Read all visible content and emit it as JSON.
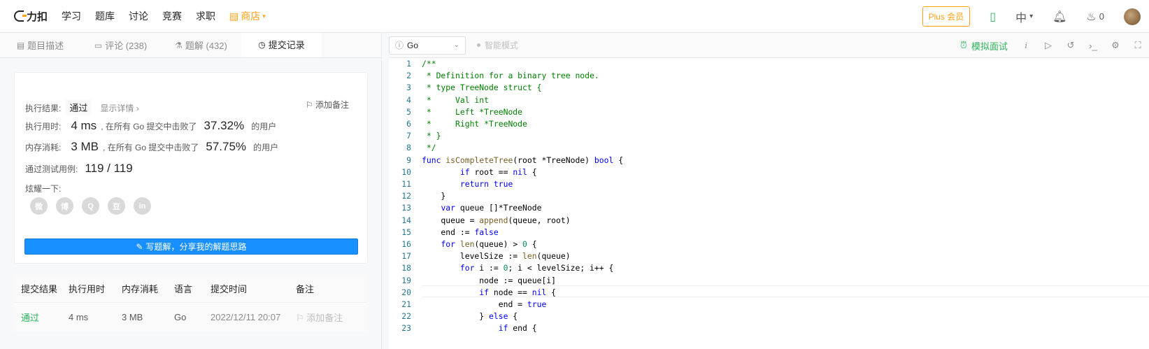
{
  "nav": {
    "logo": "力扣",
    "items": [
      "学习",
      "题库",
      "讨论",
      "竞赛",
      "求职"
    ],
    "store": "商店",
    "plus": "Plus 会员",
    "lang": "中",
    "points": "0"
  },
  "tabs": [
    {
      "label": "题目描述",
      "icon": "document-icon"
    },
    {
      "label": "评论 (238)",
      "icon": "comment-icon"
    },
    {
      "label": "题解 (432)",
      "icon": "flask-icon"
    },
    {
      "label": "提交记录",
      "icon": "clock-icon"
    }
  ],
  "result": {
    "status_label": "执行结果:",
    "status": "通过",
    "show_detail": "显示详情 ›",
    "add_note": "添加备注",
    "runtime_label": "执行用时:",
    "runtime": "4 ms",
    "runtime_mid": ", 在所有 Go 提交中击败了",
    "runtime_pct": "37.32%",
    "users": "的用户",
    "memory_label": "内存消耗:",
    "memory": "3 MB",
    "memory_mid": ", 在所有 Go 提交中击败了",
    "memory_pct": "57.75%",
    "cases_label": "通过测试用例:",
    "cases": "119 / 119",
    "share_label": "炫耀一下:",
    "share_icons": [
      "wechat-icon",
      "weibo-icon",
      "qq-icon",
      "douban-icon",
      "linkedin-icon"
    ],
    "share_glyphs": [
      "微",
      "博",
      "Q",
      "豆",
      "in"
    ],
    "write_btn": "写题解，分享我的解题思路"
  },
  "table": {
    "headers": [
      "提交结果",
      "执行用时",
      "内存消耗",
      "语言",
      "提交时间",
      "备注"
    ],
    "rows": [
      {
        "status": "通过",
        "time": "4 ms",
        "memory": "3 MB",
        "lang": "Go",
        "submitted": "2022/12/11 20:07",
        "note": "添加备注"
      }
    ]
  },
  "editor": {
    "language": "Go",
    "smart_mode": "智能模式",
    "mock_interview": "模拟面试",
    "lines": [
      "/**",
      " * Definition for a binary tree node.",
      " * type TreeNode struct {",
      " *     Val int",
      " *     Left *TreeNode",
      " *     Right *TreeNode",
      " * }",
      " */",
      "func isCompleteTree(root *TreeNode) bool {",
      "        if root == nil {",
      "        return true",
      "    }",
      "    var queue []*TreeNode",
      "    queue = append(queue, root)",
      "    end := false",
      "    for len(queue) > 0 {",
      "        levelSize := len(queue)",
      "        for i := 0; i < levelSize; i++ {",
      "            node := queue[i]",
      "            if node == nil {",
      "                end = true",
      "            } else {",
      "                if end {"
    ]
  }
}
